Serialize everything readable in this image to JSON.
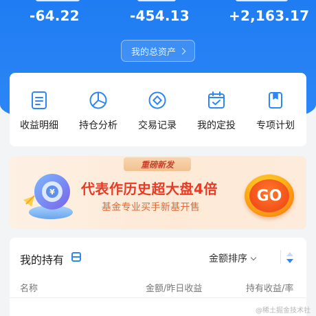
{
  "summary": {
    "stats": [
      "-64.22",
      "-454.13",
      "+2,163.17"
    ],
    "total_assets_label": "我的总资产"
  },
  "menu": [
    {
      "label": "收益明细",
      "icon": "document-icon"
    },
    {
      "label": "持仓分析",
      "icon": "pie-chart-icon"
    },
    {
      "label": "交易记录",
      "icon": "coin-icon"
    },
    {
      "label": "我的定投",
      "icon": "calendar-check-icon"
    },
    {
      "label": "专项计划",
      "icon": "bookmark-icon"
    }
  ],
  "banner": {
    "tag": "重磅新发",
    "title": "代表作历史超大盘4倍",
    "subtitle": "基金专业买手新基开售",
    "cta": "GO"
  },
  "holdings": {
    "title": "我的持有",
    "sort_label": "金额排序",
    "columns": [
      "名称",
      "金额/昨日收益",
      "持有收益/率"
    ]
  },
  "watermark": "@稀土掘金技术社区",
  "colors": {
    "primary": "#2c86f6",
    "accent": "#e83a24"
  }
}
